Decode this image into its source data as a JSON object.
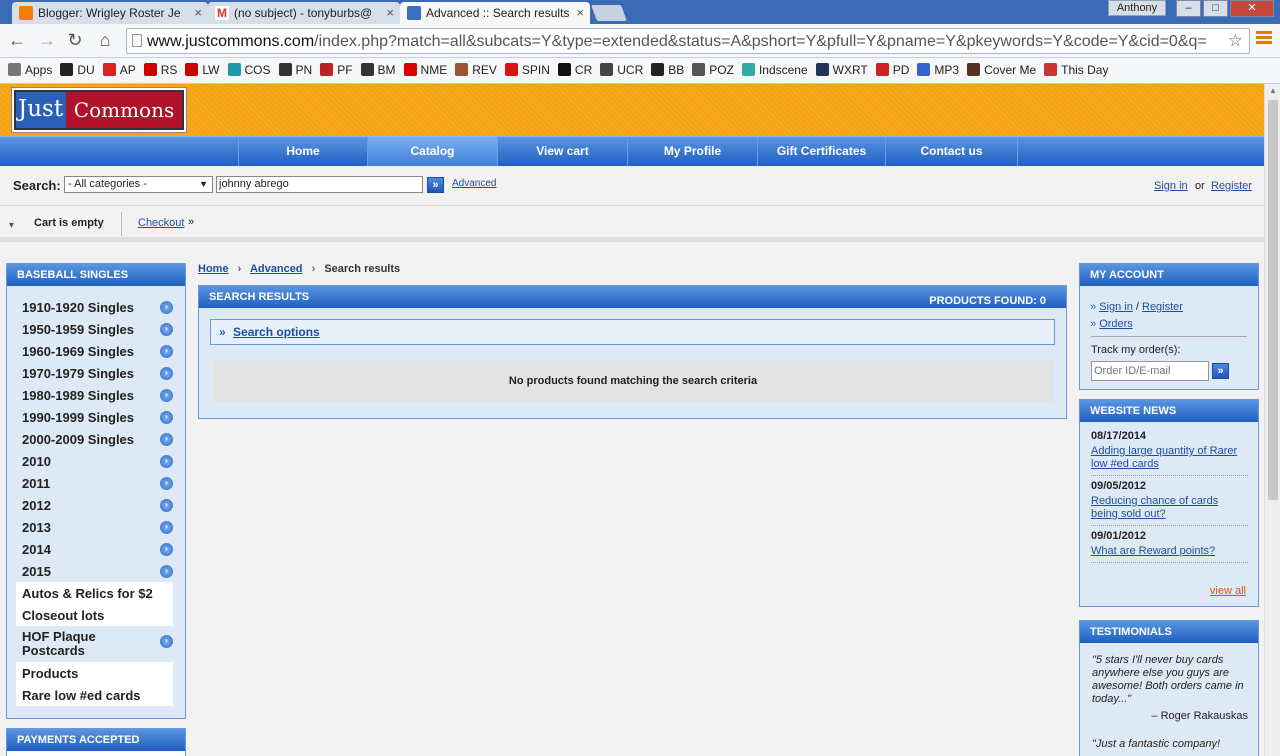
{
  "browser": {
    "tabs": [
      {
        "title": "Blogger: Wrigley Roster Je",
        "color": "#f57d00"
      },
      {
        "title": "(no subject) - tonyburbs@",
        "color": "#d33"
      },
      {
        "title": "Advanced :: Search results",
        "color": "#3a6fc4"
      }
    ],
    "profile": "Anthony",
    "url_domain": "www.justcommons.com",
    "url_rest": "/index.php?match=all&subcats=Y&type=extended&status=A&pshort=Y&pfull=Y&pname=Y&pkeywords=Y&code=Y&cid=0&q=",
    "bookmarks": [
      {
        "label": "Apps",
        "color": "#777"
      },
      {
        "label": "DU",
        "color": "#222"
      },
      {
        "label": "AP",
        "color": "#d22"
      },
      {
        "label": "RS",
        "color": "#c00"
      },
      {
        "label": "LW",
        "color": "#c00"
      },
      {
        "label": "COS",
        "color": "#29a"
      },
      {
        "label": "PN",
        "color": "#333"
      },
      {
        "label": "PF",
        "color": "#b22"
      },
      {
        "label": "BM",
        "color": "#333"
      },
      {
        "label": "NME",
        "color": "#d00"
      },
      {
        "label": "REV",
        "color": "#953"
      },
      {
        "label": "SPIN",
        "color": "#d11"
      },
      {
        "label": "CR",
        "color": "#111"
      },
      {
        "label": "UCR",
        "color": "#444"
      },
      {
        "label": "BB",
        "color": "#222"
      },
      {
        "label": "POZ",
        "color": "#555"
      },
      {
        "label": "Indscene",
        "color": "#3aa"
      },
      {
        "label": "WXRT",
        "color": "#235"
      },
      {
        "label": "PD",
        "color": "#c22"
      },
      {
        "label": "MP3",
        "color": "#36c"
      },
      {
        "label": "Cover Me",
        "color": "#532"
      },
      {
        "label": "This Day",
        "color": "#c33"
      }
    ]
  },
  "site": {
    "logo_just": "Just",
    "logo_commons": "Commons",
    "nav": [
      "Home",
      "Catalog",
      "View cart",
      "My Profile",
      "Gift Certificates",
      "Contact us"
    ],
    "search_label": "Search:",
    "category_selected": "- All categories -",
    "search_value": "johnny abrego",
    "advanced": "Advanced",
    "sign_in": "Sign in",
    "or": "or",
    "register": "Register",
    "cart": "Cart is empty",
    "checkout": "Checkout"
  },
  "left": {
    "title": "Baseball Singles",
    "items": [
      {
        "label": "1910-1920 Singles",
        "arrow": true
      },
      {
        "label": "1950-1959 Singles",
        "arrow": true
      },
      {
        "label": "1960-1969 Singles",
        "arrow": true
      },
      {
        "label": "1970-1979 Singles",
        "arrow": true
      },
      {
        "label": "1980-1989 Singles",
        "arrow": true
      },
      {
        "label": "1990-1999 Singles",
        "arrow": true
      },
      {
        "label": "2000-2009 Singles",
        "arrow": true
      },
      {
        "label": "2010",
        "arrow": true
      },
      {
        "label": "2011",
        "arrow": true
      },
      {
        "label": "2012",
        "arrow": true
      },
      {
        "label": "2013",
        "arrow": true
      },
      {
        "label": "2014",
        "arrow": true
      },
      {
        "label": "2015",
        "arrow": true
      }
    ],
    "plain1": "Autos & Relics for $2",
    "plain2": "Closeout lots",
    "hof_line1": "HOF Plaque",
    "hof_line2": "Postcards",
    "plain3": "Products",
    "plain4": "Rare low #ed cards",
    "payments_title": "Payments Accepted"
  },
  "center": {
    "crumb_home": "Home",
    "crumb_advanced": "Advanced",
    "crumb_current": "Search results",
    "results_title": "Search Results",
    "products_found": "PRODUCTS FOUND: 0",
    "search_options": "Search options",
    "no_products": "No products found matching the search criteria"
  },
  "right": {
    "account_title": "My Account",
    "sign_in": "Sign in",
    "register": "Register",
    "orders": "Orders",
    "track_label": "Track my order(s):",
    "track_placeholder": "Order ID/E-mail",
    "news_title": "Website News",
    "news": [
      {
        "date": "08/17/2014",
        "text": "Adding large quantity of Rarer low #ed cards"
      },
      {
        "date": "09/05/2012",
        "text": "Reducing chance of cards being sold out?"
      },
      {
        "date": "09/01/2012",
        "text": "What are Reward points?"
      }
    ],
    "view_all": "view all",
    "testimonials_title": "Testimonials",
    "testimonial1": "\"5 stars I'll never buy cards anywhere else you guys are awesome! Both orders came in today...\"",
    "testimonial1_author": "– Roger Rakauskas",
    "testimonial2": "\"Just a fantastic company!"
  }
}
